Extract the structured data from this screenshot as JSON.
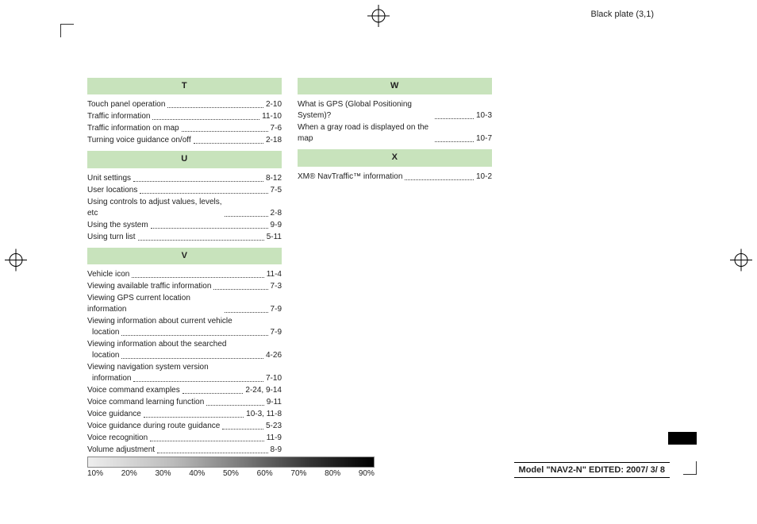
{
  "plate": "Black plate (3,1)",
  "sections": {
    "T": [
      {
        "label": "Touch panel operation",
        "page": "2-10"
      },
      {
        "label": "Traffic information",
        "page": "11-10"
      },
      {
        "label": "Traffic information on map",
        "page": "7-6"
      },
      {
        "label": "Turning voice guidance on/off",
        "page": "2-18"
      }
    ],
    "U": [
      {
        "label": "Unit settings",
        "page": "8-12"
      },
      {
        "label": "User locations",
        "page": "7-5"
      },
      {
        "label": "Using controls to adjust values, levels, etc",
        "page": "2-8"
      },
      {
        "label": "Using the system",
        "page": "9-9"
      },
      {
        "label": "Using turn list",
        "page": "5-11"
      }
    ],
    "V": [
      {
        "label": "Vehicle icon",
        "page": "11-4"
      },
      {
        "label": "Viewing available traffic information",
        "page": "7-3"
      },
      {
        "label": "Viewing GPS current location information",
        "page": "7-9"
      },
      {
        "label": "Viewing information about current vehicle",
        "sub": "location",
        "page": "7-9"
      },
      {
        "label": "Viewing information about the searched",
        "sub": "location",
        "page": "4-26"
      },
      {
        "label": "Viewing navigation system version",
        "sub": "information",
        "page": "7-10"
      },
      {
        "label": "Voice command examples",
        "page": "2-24, 9-14"
      },
      {
        "label": "Voice command learning function",
        "page": "9-11"
      },
      {
        "label": "Voice guidance",
        "page": "10-3, 11-8"
      },
      {
        "label": "Voice guidance during route guidance",
        "page": "5-23"
      },
      {
        "label": "Voice recognition",
        "page": "11-9"
      },
      {
        "label": "Volume adjustment",
        "page": "8-9"
      }
    ],
    "W": [
      {
        "label": "What is GPS (Global Positioning System)?",
        "page": "10-3"
      },
      {
        "label": "When a gray road is displayed on the map",
        "page": "10-7"
      }
    ],
    "X": [
      {
        "label": "XM® NavTraffic™ information",
        "page": "10-2"
      }
    ]
  },
  "heads": {
    "T": "T",
    "U": "U",
    "V": "V",
    "W": "W",
    "X": "X"
  },
  "ticks": [
    "10%",
    "20%",
    "30%",
    "40%",
    "50%",
    "60%",
    "70%",
    "80%",
    "90%"
  ],
  "model": {
    "prefix": "Model \"",
    "name": "NAV2-N",
    "mid": "\"  EDITED: ",
    "date": "2007/ 3/ 8"
  }
}
